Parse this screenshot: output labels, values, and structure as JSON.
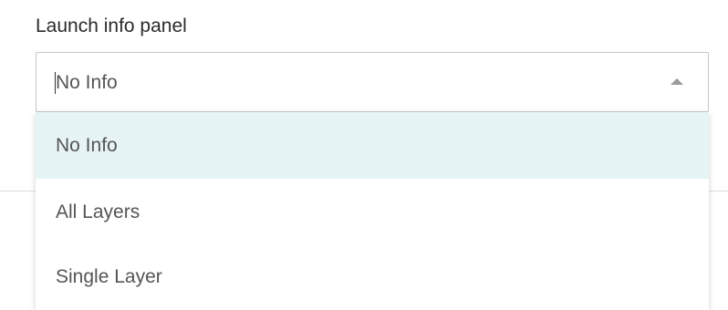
{
  "field": {
    "label": "Launch info panel",
    "selected_value": "No Info",
    "arrow_icon": "arrow-up-icon"
  },
  "dropdown": {
    "options": [
      {
        "label": "No Info",
        "highlighted": true
      },
      {
        "label": "All Layers",
        "highlighted": false
      },
      {
        "label": "Single Layer",
        "highlighted": false
      }
    ],
    "highlight_color": "#e6f4f5"
  }
}
